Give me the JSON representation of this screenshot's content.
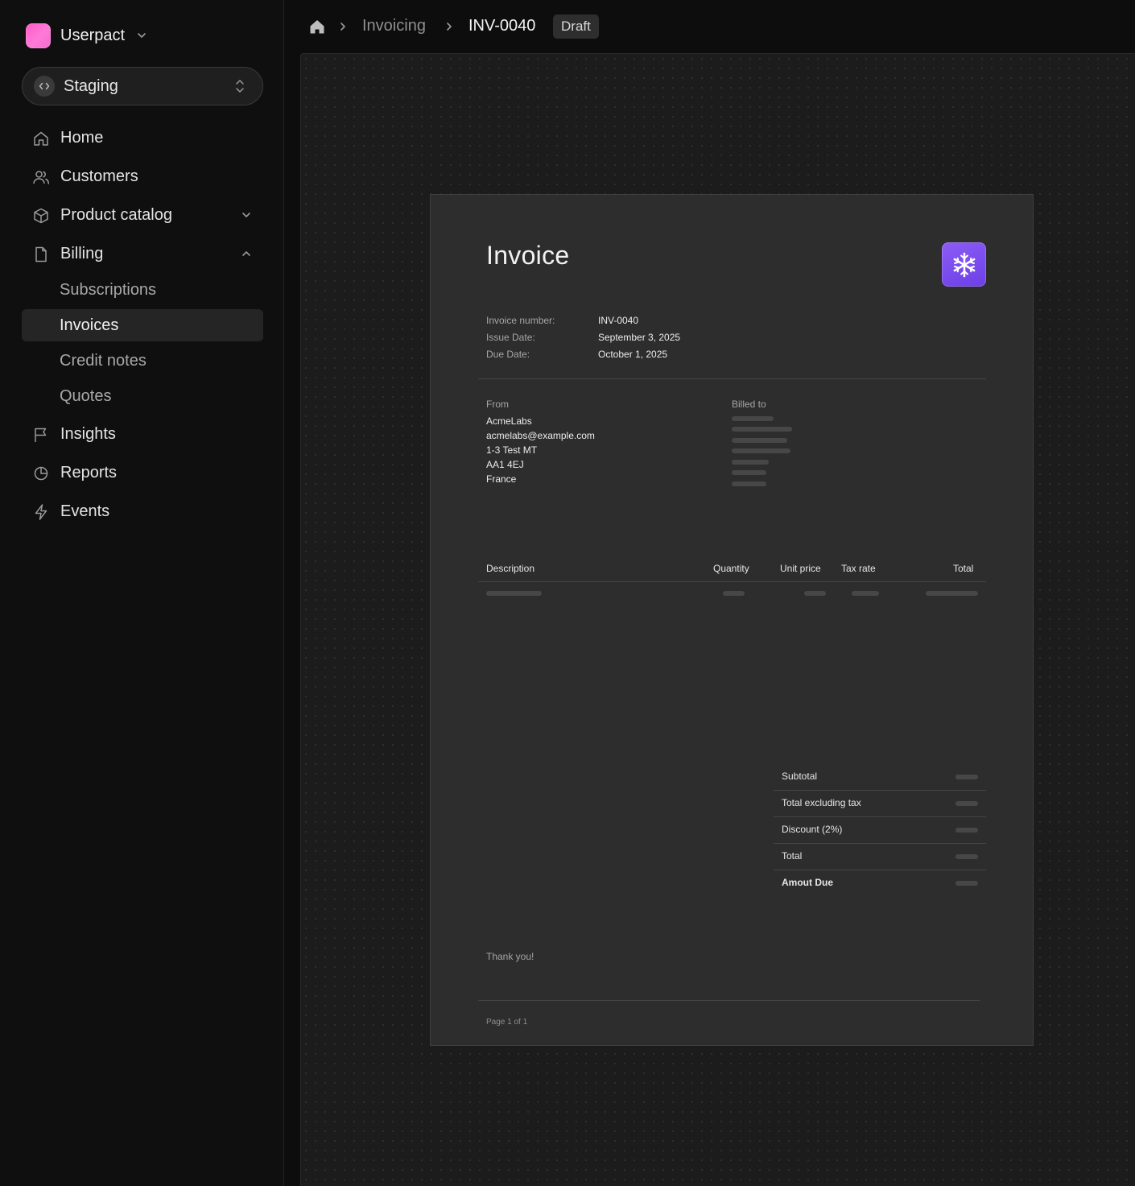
{
  "sidebar": {
    "org_name": "Userpact",
    "environment": "Staging",
    "nav": [
      {
        "label": "Home",
        "icon": "home-icon"
      },
      {
        "label": "Customers",
        "icon": "users-icon"
      },
      {
        "label": "Product catalog",
        "icon": "box-icon"
      },
      {
        "label": "Billing",
        "icon": "file-icon"
      },
      {
        "label": "Insights",
        "icon": "flag-icon"
      },
      {
        "label": "Reports",
        "icon": "pie-chart-icon"
      },
      {
        "label": "Events",
        "icon": "bolt-icon"
      }
    ],
    "billing_sub": [
      {
        "label": "Subscriptions",
        "active": false
      },
      {
        "label": "Invoices",
        "active": true
      },
      {
        "label": "Credit notes",
        "active": false
      },
      {
        "label": "Quotes",
        "active": false
      }
    ]
  },
  "breadcrumb": {
    "section": "Invoicing",
    "current": "INV-0040",
    "status": "Draft"
  },
  "invoice": {
    "title": "Invoice",
    "meta": [
      {
        "label": "Invoice number:",
        "value": "INV-0040"
      },
      {
        "label": "Issue Date:",
        "value": "September 3, 2025"
      },
      {
        "label": "Due Date:",
        "value": "October 1, 2025"
      }
    ],
    "from_label": "From",
    "from_lines": [
      "AcmeLabs",
      "acmelabs@example.com",
      "1-3 Test MT",
      "AA1 4EJ",
      "France"
    ],
    "billed_to_label": "Billed to",
    "columns": {
      "description": "Description",
      "quantity": "Quantity",
      "unit_price": "Unit price",
      "tax_rate": "Tax rate",
      "total": "Total"
    },
    "totals": [
      {
        "label": "Subtotal",
        "bold": false
      },
      {
        "label": "Total excluding tax",
        "bold": false
      },
      {
        "label": "Discount (2%)",
        "bold": false
      },
      {
        "label": "Total",
        "bold": false
      },
      {
        "label": "Amout Due",
        "bold": true
      }
    ],
    "footer_note": "Thank you!",
    "page_label": "Page 1 of 1"
  },
  "colors": {
    "org_logo": "#ff6bd0",
    "invoice_logo": "#7c4dee",
    "background": "#0d0d0d",
    "document": "#2d2d2d"
  }
}
